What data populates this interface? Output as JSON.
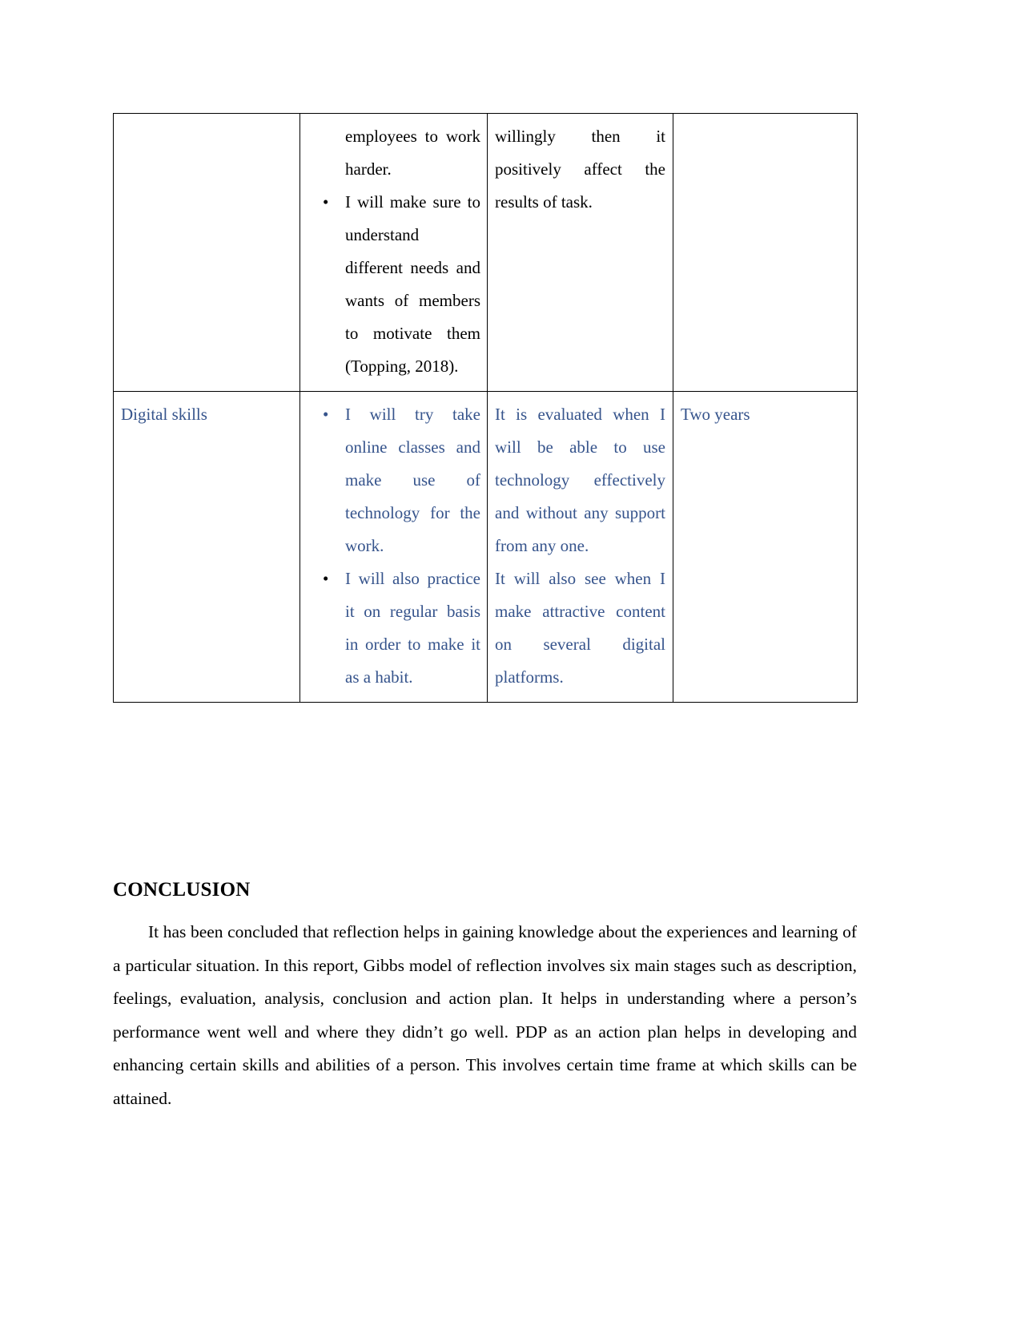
{
  "document": {
    "page_background": "#ffffff",
    "text_color_primary": "#000000",
    "text_color_accent": "#36548C"
  },
  "table": {
    "name": "pdp-action-plan-table",
    "rows": [
      {
        "id": "row-continued",
        "color": "#000000",
        "skill": "",
        "action_continuation": "employees to work harder.",
        "action_bullets": [
          {
            "marker_color": "#000000",
            "text": "I will make sure to understand different needs and wants of members to motivate them (Topping, 2018)."
          }
        ],
        "evaluation": "willingly then it positively affect the results of task.",
        "time": ""
      },
      {
        "id": "row-digital-skills",
        "color": "#36548C",
        "skill": "Digital skills",
        "action_continuation": "",
        "action_bullets": [
          {
            "marker_color": "#36548C",
            "text": "I will try take online classes and make use of technology for the work."
          },
          {
            "marker_color": "#000000",
            "text": "I will also practice it on regular basis in order to make it as a habit."
          }
        ],
        "evaluation_paragraphs": [
          "It is evaluated when I will be able to use technology effectively and without any support from any one.",
          "It will also see when I make attractive content on several digital platforms."
        ],
        "time": "Two years"
      }
    ]
  },
  "conclusion": {
    "heading": "CONCLUSION",
    "paragraph": "It has been concluded that reflection helps in gaining knowledge about the experiences and learning of a particular situation. In this report, Gibbs model of reflection involves six main stages such as description, feelings, evaluation, analysis, conclusion and action plan. It helps in understanding where a person’s performance went well and where they didn’t go well. PDP as an action plan helps in developing and enhancing certain skills and abilities of a person. This involves certain time frame at which skills can be attained."
  },
  "bullet_glyph": "•"
}
